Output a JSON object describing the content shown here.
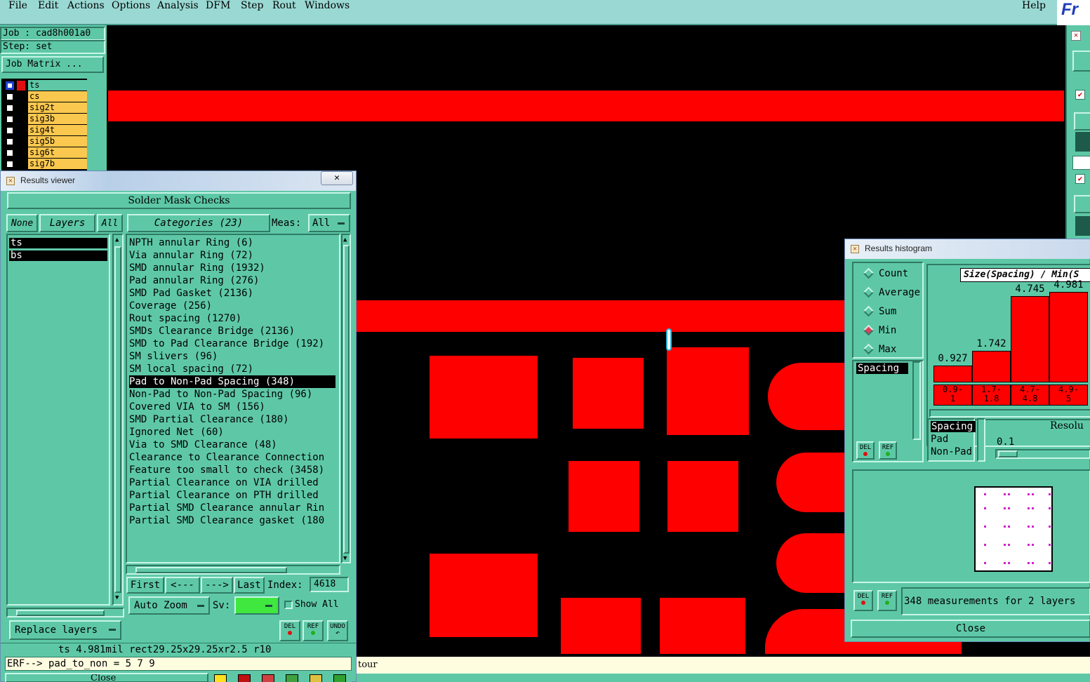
{
  "menu": {
    "items": [
      "File",
      "Edit",
      "Actions",
      "Options",
      "Analysis",
      "DFM",
      "Step",
      "Rout",
      "Windows"
    ],
    "help": "Help",
    "logo": "Fr"
  },
  "left_panel": {
    "job": "Job : cad8h001a0",
    "step": "Step: set",
    "job_matrix": "Job Matrix ...",
    "layers": [
      "ts",
      "cs",
      "sig2t",
      "sig3b",
      "sig4t",
      "sig5b",
      "sig6t",
      "sig7b"
    ]
  },
  "results_viewer": {
    "title": "Results viewer",
    "header": "Solder Mask Checks",
    "none_btn": "None",
    "layers_btn": "Layers",
    "all_btn": "All",
    "categories_btn": "Categories (23)",
    "meas_label": "Meas:",
    "meas_value": "All",
    "layer_list": [
      "ts",
      "bs"
    ],
    "categories": [
      "NPTH annular Ring (6)",
      "Via annular Ring (72)",
      "SMD annular Ring (1932)",
      "Pad annular Ring (276)",
      "SMD Pad Gasket (2136)",
      "Coverage (256)",
      "Rout spacing (1270)",
      "SMDs Clearance Bridge (2136)",
      "SMD to Pad Clearance Bridge (192)",
      "SM slivers (96)",
      "SM local spacing (72)",
      "Pad to Non-Pad Spacing (348)",
      "Non-Pad to Non-Pad Spacing (96)",
      "Covered VIA to SM (156)",
      "SMD Partial Clearance (180)",
      "Ignored Net (60)",
      "Via to SMD Clearance (48)",
      "Clearance to Clearance Connection",
      "Feature too small to check (3458)",
      "Partial Clearance on VIA drilled",
      "Partial Clearance on PTH drilled",
      "Partial SMD Clearance annular Rin",
      "Partial SMD Clearance gasket (180"
    ],
    "selected_index": 11,
    "first_btn": "First",
    "prev_btn": "<---",
    "next_btn": "--->",
    "last_btn": "Last",
    "index_label": "Index:",
    "index_value": "4618",
    "auto_zoom": "Auto Zoom",
    "sv_label": "Sv:",
    "show_all": "Show All",
    "replace_layers": "Replace layers",
    "del": "DEL",
    "ref": "REF",
    "undo": "UNDO",
    "status": "ts 4.981mil  rect29.25x29.25xr2.5  r10",
    "erf": "ERF--> pad_to_non = 5 7 9",
    "close": "Close",
    "status_right": "tour"
  },
  "histogram": {
    "title": "Results histogram",
    "modes": [
      "Count",
      "Average",
      "Sum",
      "Min",
      "Max"
    ],
    "selected_mode": "Min",
    "list_item": "Spacing",
    "chart_title": "Size(Spacing) / Min(S",
    "bins": [
      {
        "label": "0.9-1",
        "line1": "0.9-",
        "line2": "1",
        "value": 0.927
      },
      {
        "label": "1.7-1.8",
        "line1": "1.7-",
        "line2": "1.8",
        "value": 1.742
      },
      {
        "label": "4.7-4.8",
        "line1": "4.7-",
        "line2": "4.8",
        "value": 4.745
      },
      {
        "label": "4.9-5",
        "line1": "4.9-",
        "line2": "5",
        "value": 4.981
      }
    ],
    "bin_values_text": [
      "0.927",
      "1.742",
      "4.745",
      "4.981"
    ],
    "type_list": [
      "Spacing",
      "Pad",
      "Non-Pad"
    ],
    "resolution_label": "Resolu",
    "resolution_value": "0.1",
    "summary": "348 measurements for 2 layers",
    "close": "Close",
    "del": "DEL",
    "ref": "REF"
  },
  "colors": {
    "motif": "#5ec8a6",
    "menubar": "#9ad9d3",
    "feature_red": "#ff0000",
    "layer_yellow": "#fbc84f",
    "canvas": "#000000"
  }
}
